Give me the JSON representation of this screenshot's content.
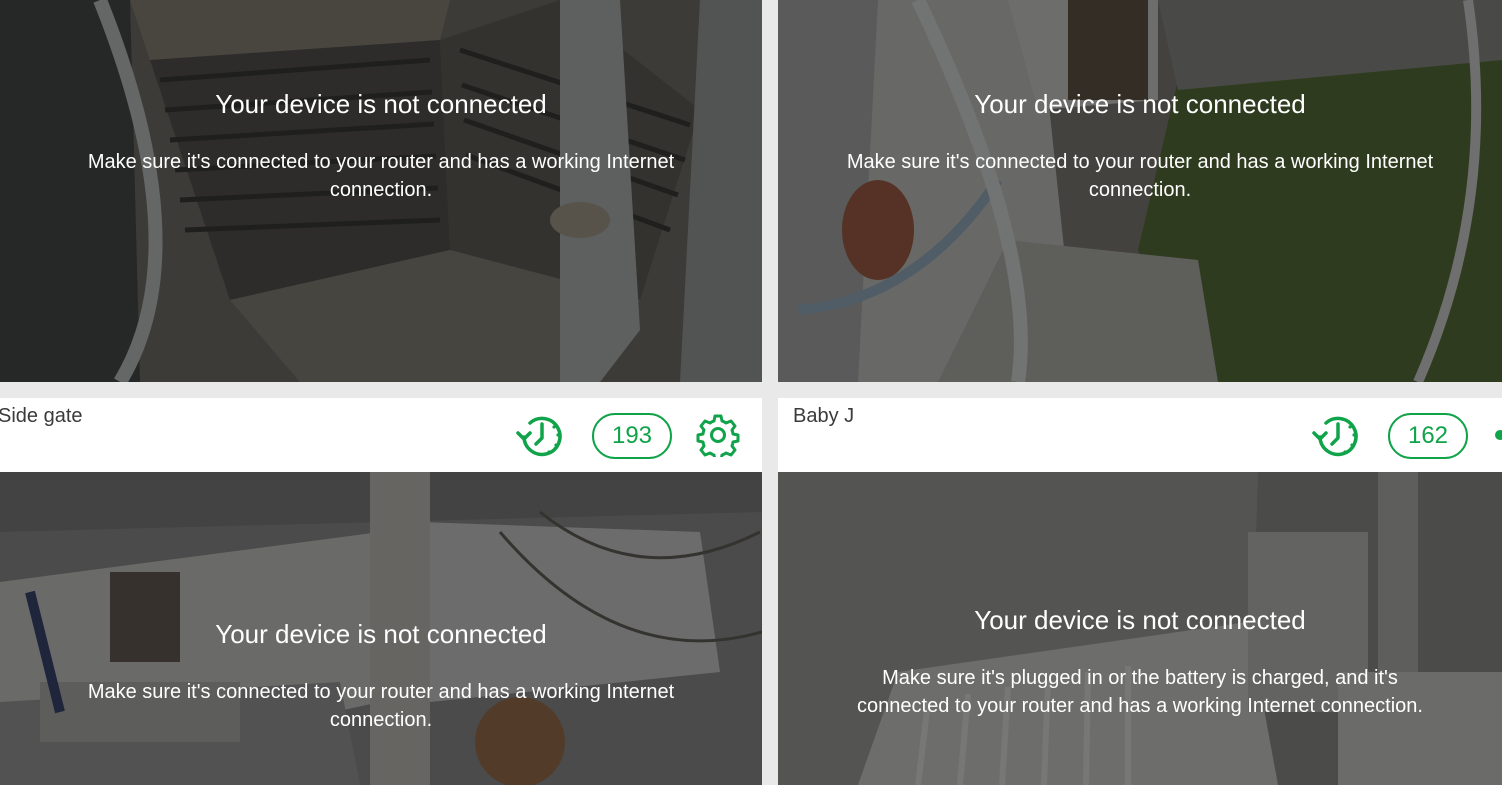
{
  "accent_color": "#10a34a",
  "cameras": [
    {
      "id": "top-left",
      "offline_title": "Your device is not connected",
      "offline_message": "Make sure it's connected to your router and has a working Internet connection."
    },
    {
      "id": "top-right",
      "offline_title": "Your device is not connected",
      "offline_message": "Make sure it's connected to your router and has a working Internet connection."
    },
    {
      "id": "side-gate",
      "name": "Side gate",
      "event_count": "193",
      "icons": [
        "history-icon",
        "gear-icon"
      ],
      "offline_title": "Your device is not connected",
      "offline_message": "Make sure it's connected to your router and has a working Internet connection."
    },
    {
      "id": "baby-j",
      "name": "Baby J",
      "event_count": "162",
      "icons": [
        "history-icon"
      ],
      "offline_title": "Your device is not connected",
      "offline_message": "Make sure it's plugged in or the battery is charged, and it's connected to your router and has a working Internet connection."
    }
  ]
}
